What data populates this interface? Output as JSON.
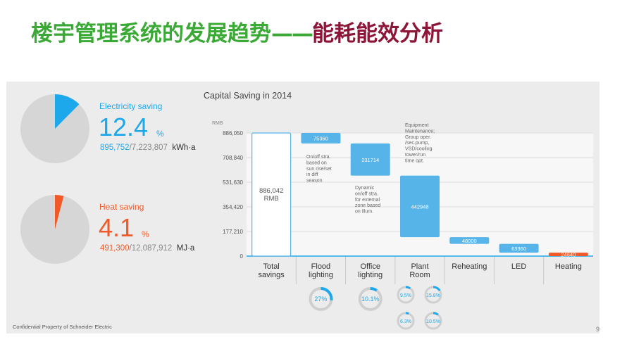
{
  "slide": {
    "title_part1": "楼宇管理系统的发展趋势",
    "title_dash": "——",
    "title_part2": "能耗能效分析",
    "footer": "Confidential Property of Schneider Electric",
    "page_number": "9"
  },
  "kpis": [
    {
      "label": "Electricity saving",
      "value": "12.4",
      "unit": "%",
      "detail_saved": "895,752",
      "detail_total": "/7,223,807",
      "detail_unit": "kWh·a",
      "color": "#1ea8ec",
      "fraction": 0.124
    },
    {
      "label": "Heat saving",
      "value": "4.1",
      "unit": "%",
      "detail_saved": "491,300",
      "detail_total": "/12,087,912",
      "detail_unit": "MJ·a",
      "color": "#f05a28",
      "fraction": 0.041
    }
  ],
  "chart_data": {
    "type": "bar",
    "subtype": "waterfall",
    "title": "Capital Saving in 2014",
    "ylabel": "RMB",
    "ylim": [
      0,
      886050
    ],
    "yticks": [
      {
        "value": 886050,
        "label": "886,050"
      },
      {
        "value": 708840,
        "label": "708,840"
      },
      {
        "value": 531630,
        "label": "531,630"
      },
      {
        "value": 354420,
        "label": "354,420"
      },
      {
        "value": 177210,
        "label": "177,210"
      },
      {
        "value": 0,
        "label": "0"
      }
    ],
    "categories": [
      "Total savings",
      "Flood lighting",
      "Office lighting",
      "Plant Room",
      "Reheating",
      "LED",
      "Heating"
    ],
    "category_lines": [
      [
        "Total",
        "savings"
      ],
      [
        "Flood",
        "lighting"
      ],
      [
        "Office",
        "lighting"
      ],
      [
        "Plant",
        "Room"
      ],
      [
        "Reheating"
      ],
      [
        "LED"
      ],
      [
        "Heating"
      ]
    ],
    "values": [
      886042,
      75360,
      231714,
      442948,
      48000,
      63360,
      24640
    ],
    "bar_labels": [
      "886,042\nRMB",
      "75360",
      "231714",
      "442948",
      "48000",
      "63360",
      "24640"
    ],
    "total_color": "#ffffff",
    "bar_color": "#56b4e9",
    "last_color": "#f05a28",
    "annotations": [
      {
        "category": 1,
        "text": "On/off stra.\nbased on\nsun rise/set\nin diff\nseason"
      },
      {
        "category": 2,
        "text": "Dynamic\non/off stra.\nfor external\nzone based\non illum."
      },
      {
        "category": 3,
        "text": "Equipment\nMaintenance;\nGroup oper.\n/sec.pump,\nVSD/cooling\ntower/run\ntime opt."
      }
    ],
    "rings": [
      {
        "category": 1,
        "label": "27%",
        "value": 0.27
      },
      {
        "category": 2,
        "label": "10.1%",
        "value": 0.101
      },
      {
        "category": 3,
        "label": "9.5%",
        "value": 0.095
      },
      {
        "category": 3,
        "label": "15.8%",
        "value": 0.158
      },
      {
        "category": 3,
        "label": "6.3%",
        "value": 0.063
      },
      {
        "category": 3,
        "label": "10.5%",
        "value": 0.105
      }
    ],
    "grid": true
  }
}
